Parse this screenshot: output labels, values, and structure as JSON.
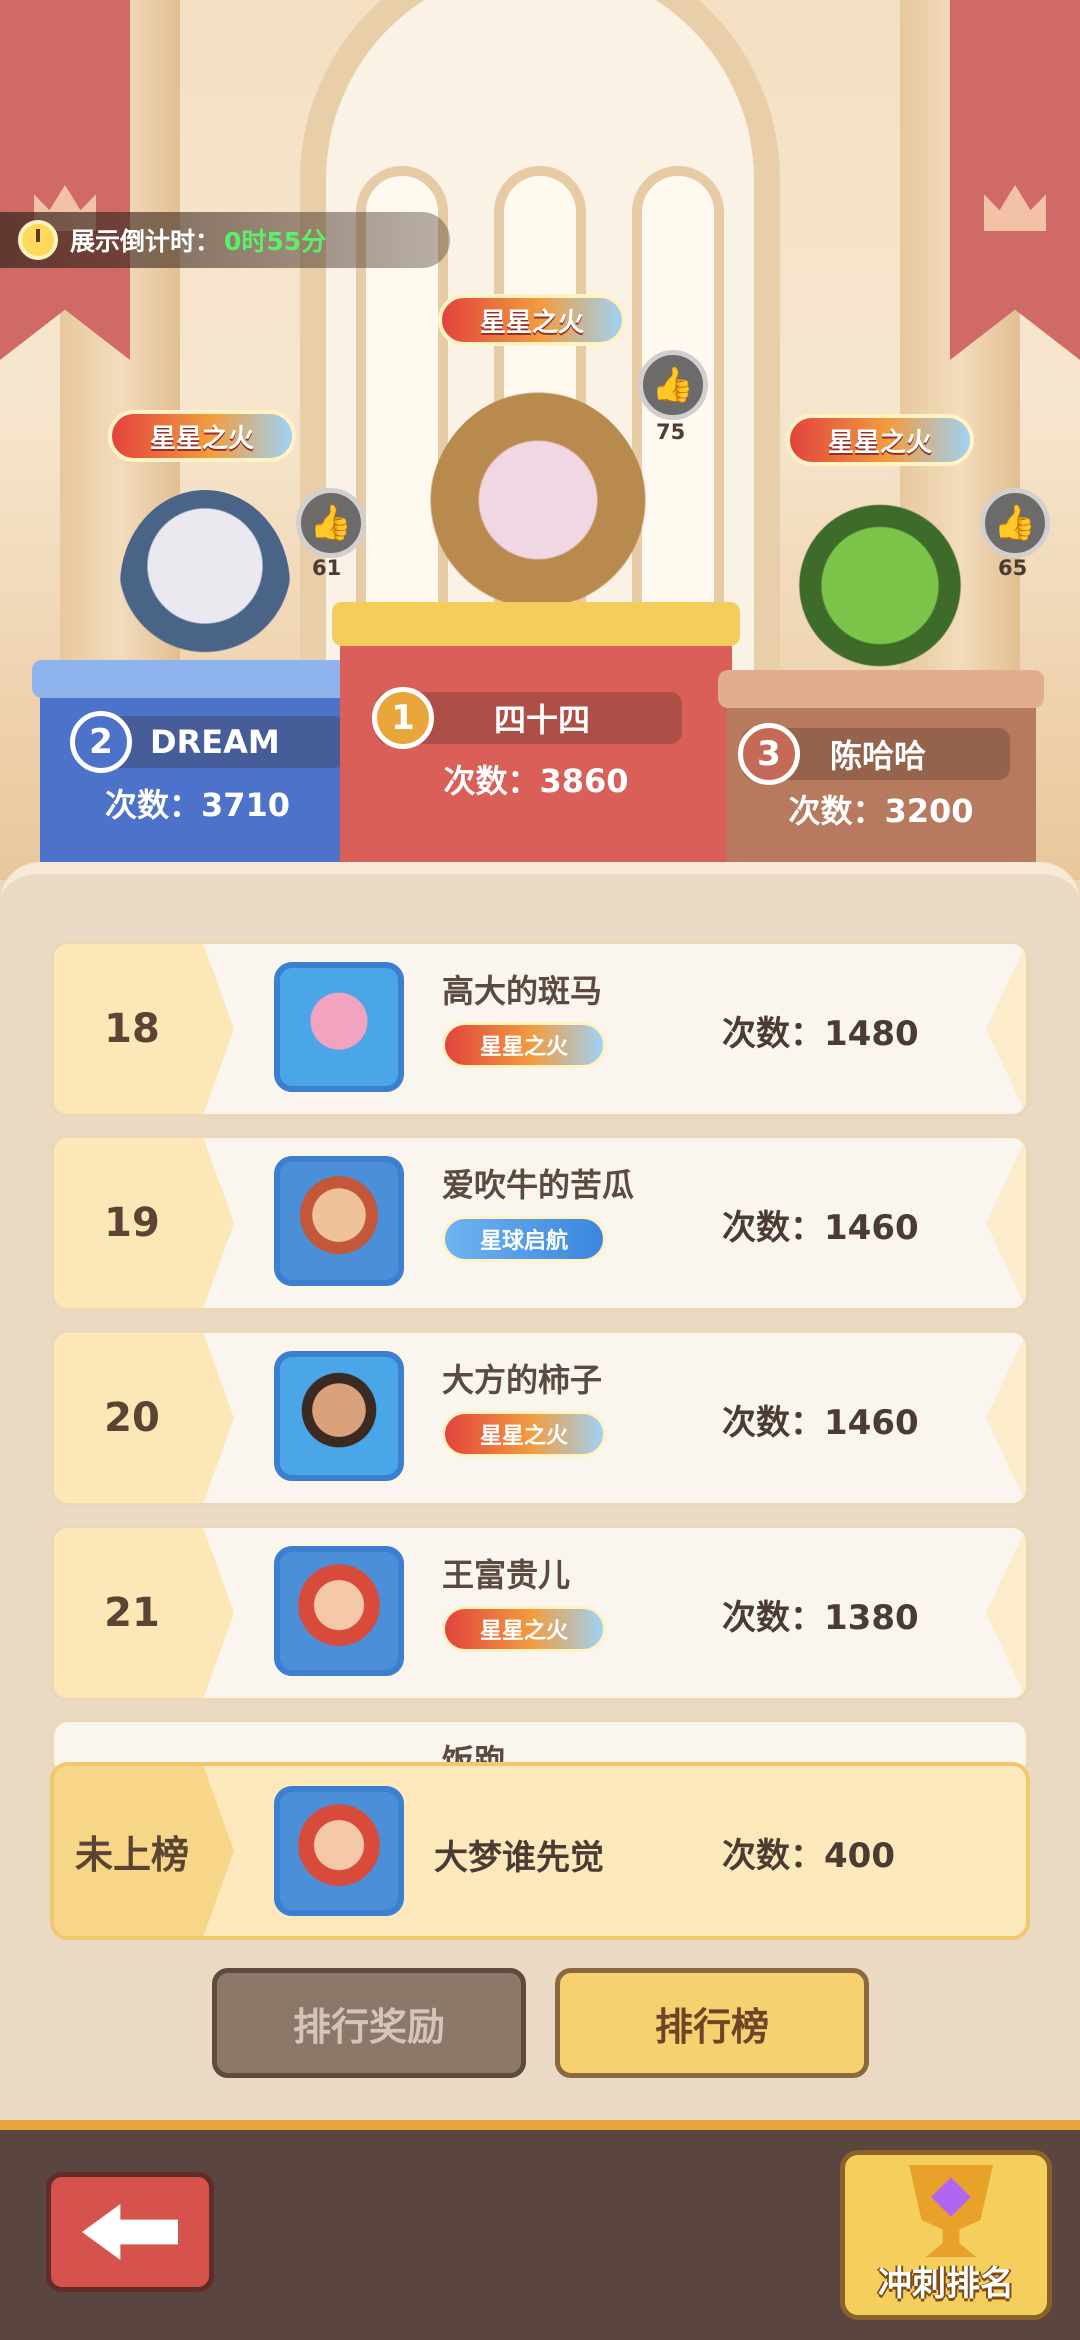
{
  "countdown": {
    "label": "展示倒计时：",
    "value": "0时55分"
  },
  "podium": [
    {
      "rank": "2",
      "name": "DREAM",
      "score": "次数：3710",
      "title": "星星之火",
      "likes": "61",
      "medal_color": "#4c73c9"
    },
    {
      "rank": "1",
      "name": "四十四",
      "score": "次数：3860",
      "title": "星星之火",
      "likes": "75",
      "medal_color": "#e9a63a"
    },
    {
      "rank": "3",
      "name": "陈哈哈",
      "score": "次数：3200",
      "title": "星星之火",
      "likes": "65",
      "medal_color": "#c46a56"
    }
  ],
  "list": [
    {
      "rank": "18",
      "name": "高大的斑马",
      "title": "星星之火",
      "score": "次数：1480"
    },
    {
      "rank": "19",
      "name": "爱吹牛的苦瓜",
      "title": "星球启航",
      "score": "次数：1460"
    },
    {
      "rank": "20",
      "name": "大方的柿子",
      "title": "星星之火",
      "score": "次数：1460"
    },
    {
      "rank": "21",
      "name": "王富贵儿",
      "title": "星星之火",
      "score": "次数：1380"
    },
    {
      "rank": "",
      "name": "饭跑",
      "title": "",
      "score": ""
    }
  ],
  "me": {
    "rank": "未上榜",
    "name": "大梦谁先觉",
    "score": "次数：400"
  },
  "tabs": {
    "rewards": "排行奖励",
    "leaderboard": "排行榜"
  },
  "bottom": {
    "sprint": "冲刺排名"
  },
  "colors": {
    "accent": "#f6d170",
    "title_red": "#e2433c",
    "gold": "#e8a63e"
  },
  "icons": {
    "back": "back-arrow-icon",
    "like": "thumbs-up-icon",
    "trophy": "trophy-icon",
    "clock": "clock-icon"
  }
}
